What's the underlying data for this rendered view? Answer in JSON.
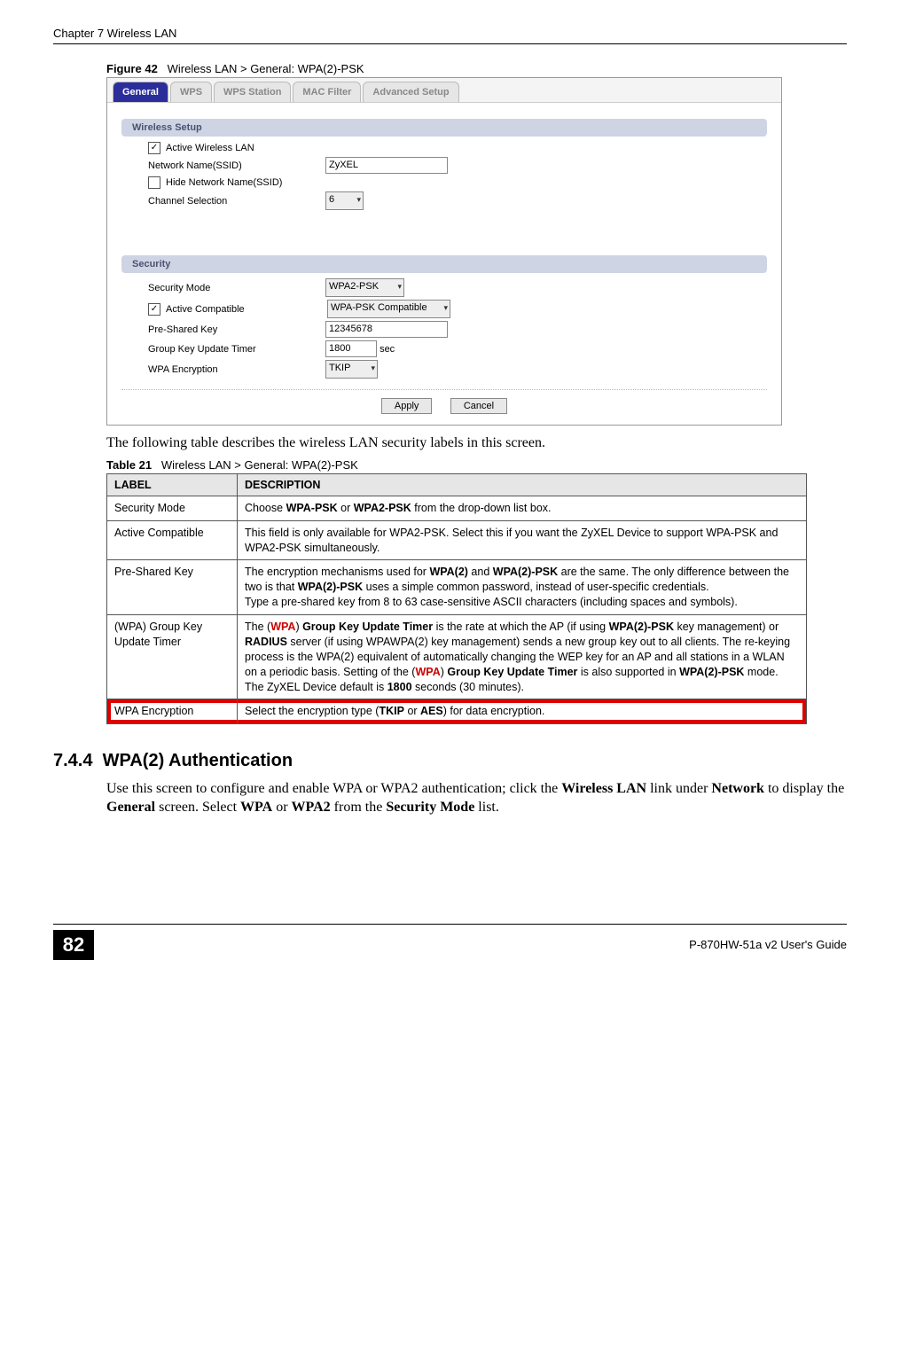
{
  "header": {
    "chapter": "Chapter 7 Wireless LAN"
  },
  "figure": {
    "label": "Figure 42",
    "title": "Wireless LAN > General: WPA(2)-PSK"
  },
  "screenshot": {
    "tabs": [
      "General",
      "WPS",
      "WPS Station",
      "MAC Filter",
      "Advanced Setup"
    ],
    "active_tab_index": 0,
    "sections": {
      "wireless_setup": {
        "title": "Wireless Setup",
        "active_wlan_label": "Active Wireless LAN",
        "active_wlan_checked": "✓",
        "ssid_label": "Network Name(SSID)",
        "ssid_value": "ZyXEL",
        "hide_ssid_label": "Hide Network Name(SSID)",
        "hide_ssid_checked": "",
        "channel_label": "Channel Selection",
        "channel_value": "6"
      },
      "security": {
        "title": "Security",
        "mode_label": "Security Mode",
        "mode_value": "WPA2-PSK",
        "compat_label": "Active Compatible",
        "compat_checked": "✓",
        "compat_value": "WPA-PSK Compatible",
        "psk_label": "Pre-Shared Key",
        "psk_value": "12345678",
        "gkt_label": "Group Key Update Timer",
        "gkt_value": "1800",
        "gkt_unit": "sec",
        "enc_label": "WPA Encryption",
        "enc_value": "TKIP"
      }
    },
    "buttons": {
      "apply": "Apply",
      "cancel": "Cancel"
    }
  },
  "intro_text": "The following table describes the wireless LAN security labels in this screen.",
  "table": {
    "label": "Table 21",
    "title": "Wireless LAN > General: WPA(2)-PSK",
    "headers": [
      "LABEL",
      "DESCRIPTION"
    ],
    "rows": [
      {
        "label": "Security Mode",
        "desc_html": "Choose <b>WPA-PSK</b> or <b>WPA2-PSK</b> from the drop-down list box."
      },
      {
        "label": "Active Compatible",
        "desc_html": "This field is only available for WPA2-PSK. Select this if you want the ZyXEL Device to support WPA-PSK and WPA2-PSK simultaneously."
      },
      {
        "label": "Pre-Shared Key",
        "desc_html": "The encryption mechanisms used for <b>WPA(2)</b> and <b>WPA(2)-PSK</b> are the same. The only difference between the two is that <b>WPA(2)-PSK</b> uses a simple common password, instead of user-specific credentials.<br>Type a pre-shared key from 8 to 63 case-sensitive ASCII characters (including spaces and symbols)."
      },
      {
        "label": "(WPA) Group Key Update Timer",
        "desc_html": "The (<span class='red'>WPA</span>) <b>Group Key Update Timer</b> is the rate at which the AP (if using <b>WPA(2)-PSK</b> key management) or <b>RADIUS</b> server (if using WPAWPA(2) key management) sends a new group key out to all clients. The re-keying process is the WPA(2) equivalent of automatically changing the WEP key for an AP and all stations in a WLAN on a periodic basis. Setting of the (<span class='red'>WPA</span>) <b>Group Key Update Timer</b> is also supported in <b>WPA(2)-PSK</b> mode. The ZyXEL Device default is <b>1800</b> seconds (30 minutes)."
      },
      {
        "label": "WPA Encryption",
        "desc_html": "Select the encryption type (<b>TKIP</b> or <b>AES</b>) for data encryption.",
        "highlight": true
      }
    ]
  },
  "section": {
    "number": "7.4.4",
    "title": "WPA(2) Authentication",
    "body_html": "Use this screen to configure and enable WPA or WPA2 authentication; click the <b>Wireless LAN</b> link under <b>Network</b> to display the <b>General</b> screen. Select <b>WPA</b> or <b>WPA2</b> from the <b>Security Mode</b> list."
  },
  "footer": {
    "page": "82",
    "guide": "P-870HW-51a v2 User's Guide"
  }
}
